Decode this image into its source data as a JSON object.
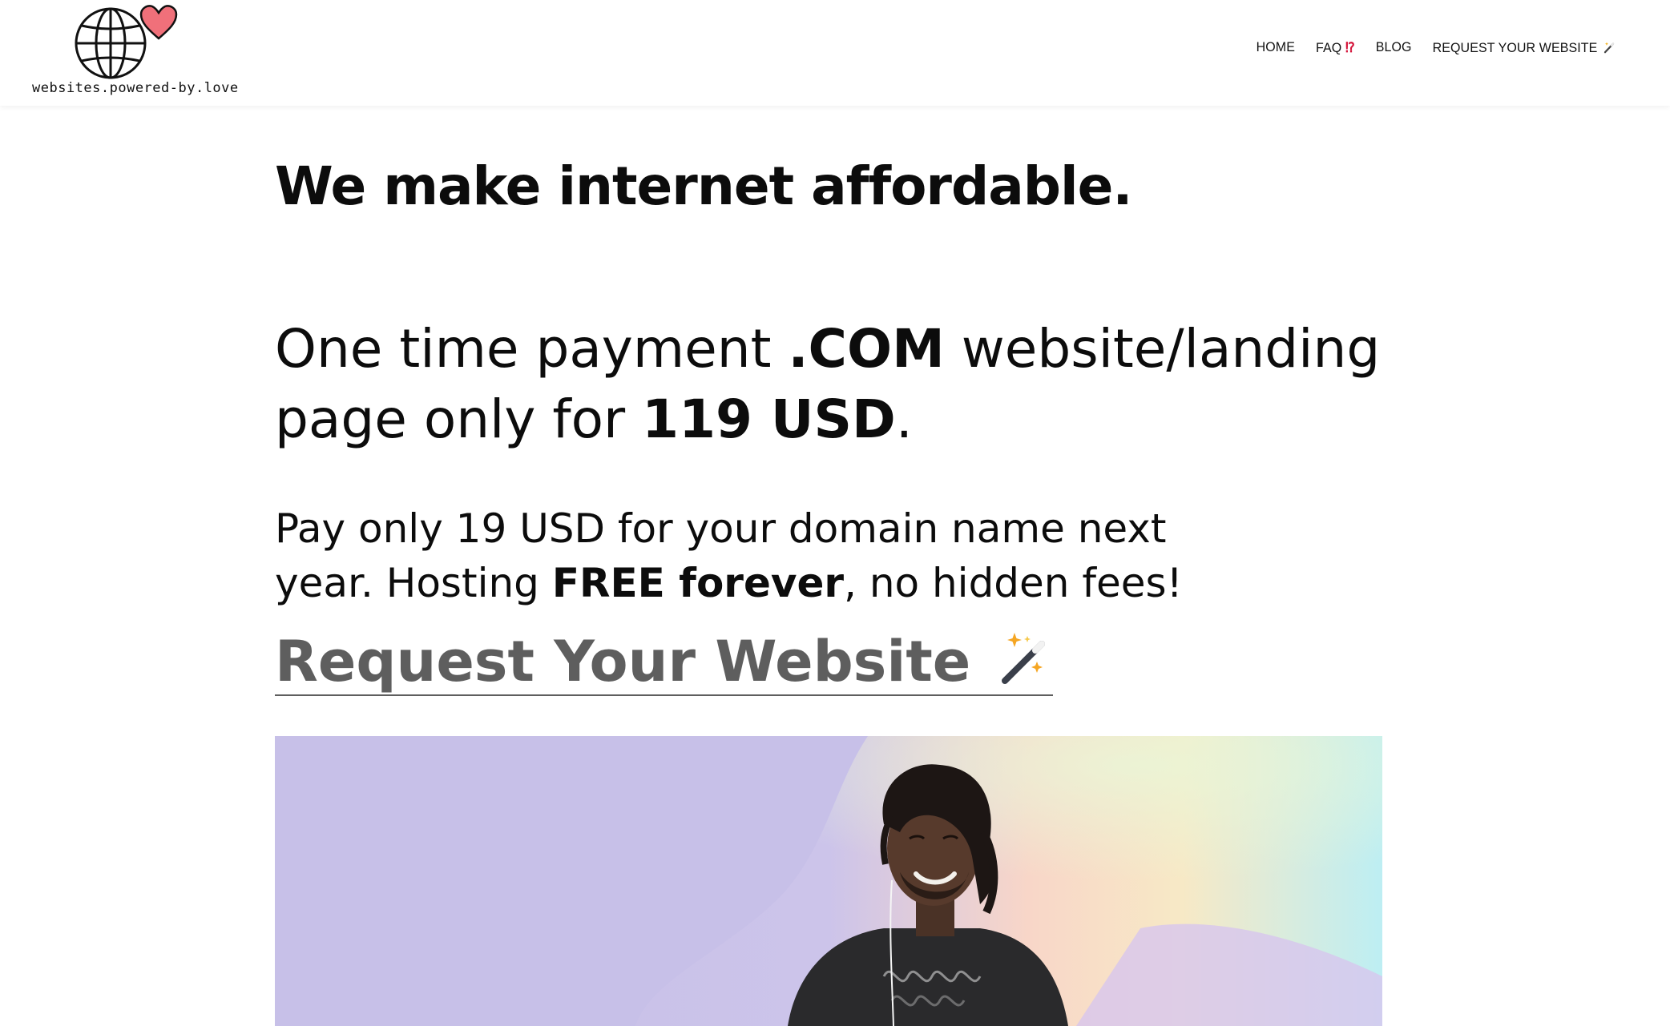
{
  "brand": {
    "logo_text": "websites.powered-by.love",
    "logo_icon": "globe-heart-icon"
  },
  "nav": {
    "items": [
      {
        "label": "HOME"
      },
      {
        "label": "FAQ",
        "suffix": "⁉"
      },
      {
        "label": "BLOG"
      },
      {
        "label": "REQUEST YOUR WEBSITE",
        "icon": "magic-wand-icon"
      }
    ]
  },
  "hero": {
    "headline": "We make internet affordable.",
    "offer": {
      "part1": "One time payment ",
      "bold1": ".COM",
      "part2": " website/landing page only  for ",
      "bold2": "119 USD",
      "part3": "."
    },
    "domain_note": {
      "part1": "Pay only 19 USD for your domain name next year. Hosting ",
      "bold": "FREE forever",
      "part2": ", no hidden fees!"
    },
    "cta_label": "Request Your Website",
    "cta_icon": "magic-wand-icon",
    "image_alt_icon": "smiling-man-photo"
  },
  "colors": {
    "accent_red": "#d4143a",
    "heart": "#f0707a",
    "cta_gray": "#5e5e5e",
    "hero_lilac": "#c8c0e8",
    "hero_peach": "#fbd3c8",
    "hero_cyan": "#bfeff2"
  }
}
